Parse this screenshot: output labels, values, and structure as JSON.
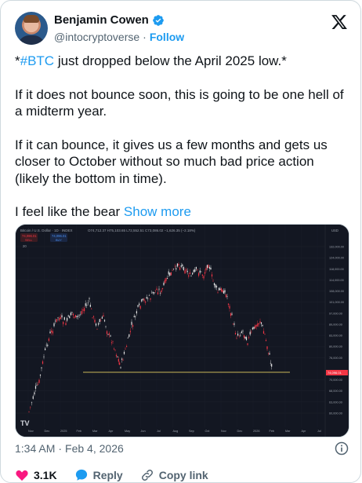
{
  "author": {
    "name": "Benjamin Cowen",
    "handle": "@intocryptoverse",
    "separator": "·",
    "follow_label": "Follow"
  },
  "tweet": {
    "line1_prefix": "*",
    "hashtag": "#BTC",
    "line1_suffix": " just dropped below the April 2025 low.*",
    "para2": "If it does not bounce soon, this is going to be one hell of a midterm year.",
    "para3": "If it can bounce, it gives us a few months and gets us closer to October without so much bad price action (likely the bottom in time).",
    "para4": "I feel like the bear ",
    "show_more": "Show more"
  },
  "chart_image": {
    "title_text": "Bitcoin / U.S. Dollar · 1D · INDEX",
    "ohlc_text": "O74,712.37 H75,103.65 L72,552.51 C73,086.02 −1,626.35 (−2.18%)",
    "sell_price": "74,096.01",
    "sell_label": "SELL",
    "buy_price": "74,096.01",
    "buy_label": "BUY",
    "indicator_count": "20",
    "currency": "USD",
    "price_labels": [
      "132,000.00",
      "124,000.00",
      "118,000.00",
      "114,000.00",
      "108,000.00",
      "101,000.00",
      "97,000.00",
      "89,000.00",
      "83,000.00",
      "80,000.00",
      "76,000.00",
      "74,096.01",
      "70,000.00",
      "68,000.00",
      "63,000.00",
      "60,000.00"
    ],
    "time_labels": [
      "Nov",
      "Dec",
      "2025",
      "Feb",
      "Mar",
      "Apr",
      "May",
      "Jun",
      "Jul",
      "Aug",
      "Sep",
      "Oct",
      "Nov",
      "Dec",
      "2026",
      "Feb",
      "Mar",
      "Apr",
      "Jul"
    ],
    "tv_logo": "TV"
  },
  "meta": {
    "time": "1:34 AM",
    "separator": "·",
    "date": "Feb 4, 2026"
  },
  "actions": {
    "likes": "3.1K",
    "reply": "Reply",
    "copy_link": "Copy link"
  },
  "colors": {
    "accent": "#1d9bf0",
    "like": "#f91880",
    "chart_bg": "#131722",
    "up": "#e5e5e5",
    "down": "#f23645"
  }
}
